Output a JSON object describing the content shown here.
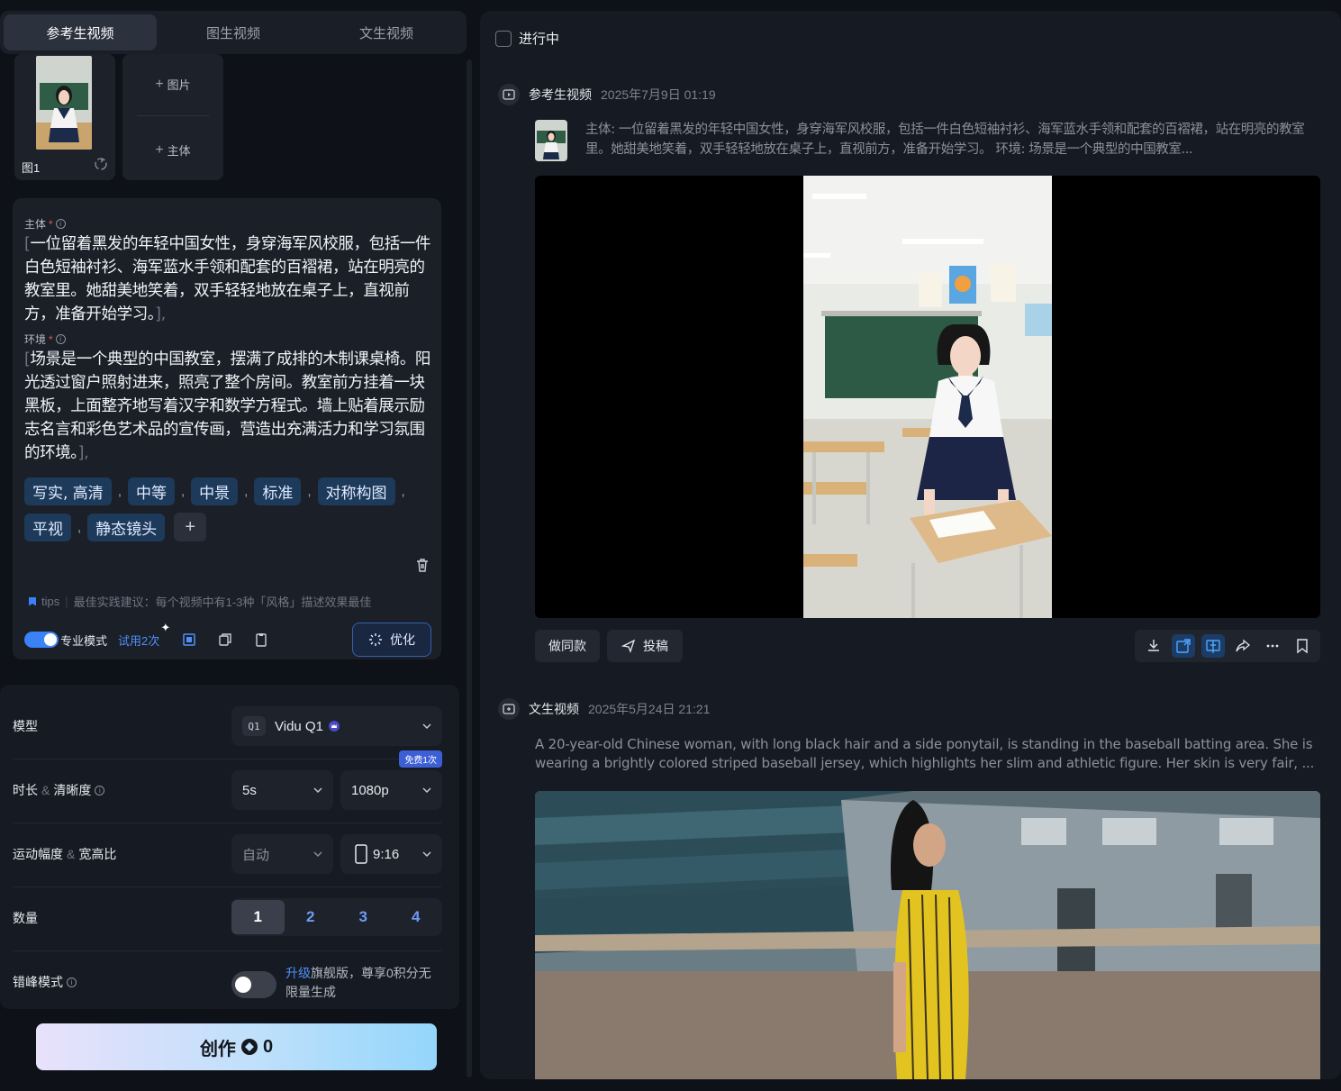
{
  "tabs": [
    "参考生视频",
    "图生视频",
    "文生视频"
  ],
  "uploads": {
    "image_label": "图1",
    "add_image": "图片",
    "add_subject": "主体"
  },
  "prompt": {
    "subject_label": "主体",
    "subject_text": "一位留着黑发的年轻中国女性，身穿海军风校服，包括一件白色短袖衬衫、海军蓝水手领和配套的百褶裙，站在明亮的教室里。她甜美地笑着，双手轻轻地放在桌子上，直视前方，准备开始学习。",
    "env_label": "环境",
    "env_text": "场景是一个典型的中国教室，摆满了成排的木制课桌椅。阳光透过窗户照射进来，照亮了整个房间。教室前方挂着一块黑板，上面整齐地写着汉字和数学方程式。墙上贴着展示励志名言和彩色艺术品的宣传画，营造出充满活力和学习氛围的环境。",
    "tags": [
      "写实, 高清",
      "中等",
      "中景",
      "标准",
      "对称构图",
      "平视",
      "静态镜头"
    ],
    "tips_label": "tips",
    "tips_text": "最佳实践建议：每个视频中有1-3种「风格」描述效果最佳",
    "pro_mode_label": "专业模式",
    "trial_label": "试用2次",
    "optimize_label": "优化"
  },
  "settings": {
    "model_label": "模型",
    "model_value": "Vidu Q1",
    "model_badge": "Q1",
    "duration_label": "时长",
    "clarity_label": "清晰度",
    "duration_value": "5s",
    "resolution_value": "1080p",
    "free_badge": "免费1次",
    "motion_label": "运动幅度",
    "ratio_label": "宽高比",
    "motion_value": "自动",
    "ratio_value": "9:16",
    "count_label": "数量",
    "counts": [
      "1",
      "2",
      "3",
      "4"
    ],
    "selected_count": "1",
    "offpeak_label": "错峰模式",
    "upgrade_link": "升级",
    "upgrade_text": "旗舰版，尊享0积分无限量生成"
  },
  "create": {
    "label": "创作",
    "cost": "0"
  },
  "feed": {
    "filter_label": "进行中",
    "entries": [
      {
        "type": "参考生视频",
        "date": "2025年7月9日 01:19",
        "desc": "主体: 一位留着黑发的年轻中国女性，身穿海军风校服，包括一件白色短袖衬衫、海军蓝水手领和配套的百褶裙，站在明亮的教室里。她甜美地笑着，双手轻轻地放在桌子上，直视前方，准备开始学习。 环境: 场景是一个典型的中国教室..."
      },
      {
        "type": "文生视频",
        "date": "2025年5月24日 21:21",
        "desc": "A 20-year-old Chinese woman, with long black hair and a side ponytail, is standing in the baseball batting area. She is wearing a brightly colored striped baseball jersey, which highlights her slim and athletic figure. Her skin is very fair, ..."
      }
    ],
    "same_style_label": "做同款",
    "submit_label": "投稿"
  },
  "colors": {
    "accent": "#3b82f6",
    "tag_bg": "#1e3a5a",
    "panel": "#161a22"
  }
}
